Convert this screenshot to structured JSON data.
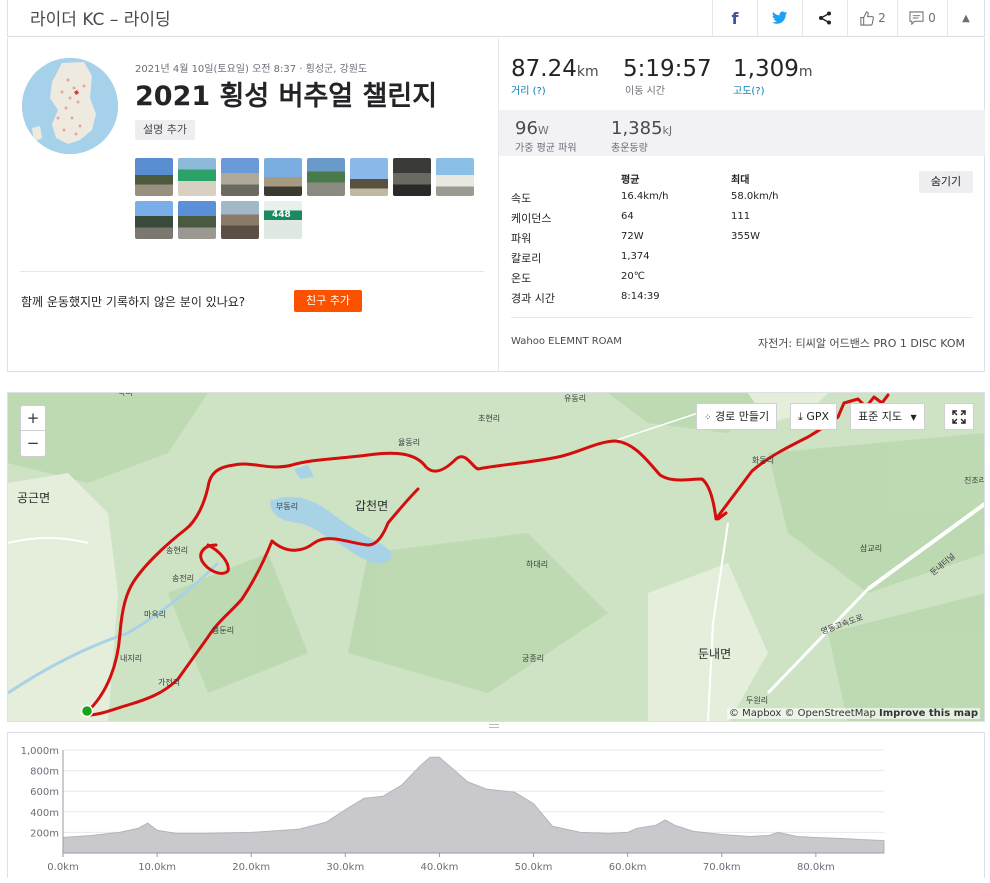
{
  "header": {
    "title": "라이더 KC – 라이딩",
    "kudos_count": "2",
    "comment_count": "0"
  },
  "activity": {
    "meta": "2021년 4월 10일(토요일) 오전 8:37 · 횡성군, 강원도",
    "title": "2021 횡성 버추얼 챌린지",
    "add_description": "설명 추가",
    "friends_question": "함께 운동했지만 기록하지 않은 분이 있나요?",
    "add_friends": "친구 추가",
    "photo_sign_text": "448"
  },
  "stats": {
    "distance": {
      "value": "87.24",
      "unit": "km",
      "label": "거리 (?)"
    },
    "moving_time": {
      "value": "5:19:57",
      "label": "이동 시간"
    },
    "elevation": {
      "value": "1,309",
      "unit": "m",
      "label": "고도(?)"
    },
    "weighted_power": {
      "value": "96",
      "unit": "W",
      "label": "가중 평균 파워"
    },
    "total_work": {
      "value": "1,385",
      "unit": "kJ",
      "label": "총운동량"
    }
  },
  "detail_table": {
    "col_avg": "평균",
    "col_max": "최대",
    "hide_label": "숨기기",
    "rows": [
      {
        "label": "속도",
        "avg": "16.4km/h",
        "max": "58.0km/h"
      },
      {
        "label": "케이던스",
        "avg": "64",
        "max": "111"
      },
      {
        "label": "파워",
        "avg": "72W",
        "max": "355W"
      },
      {
        "label": "칼로리",
        "avg": "1,374",
        "max": ""
      },
      {
        "label": "온도",
        "avg": "20℃",
        "max": ""
      },
      {
        "label": "경과 시간",
        "avg": "8:14:39",
        "max": ""
      }
    ],
    "device": "Wahoo ELEMNT ROAM",
    "bike": "자전거: 티씨알 어드밴스 PRO 1 DISC KOM"
  },
  "map": {
    "zoom_in": "+",
    "zoom_out": "−",
    "route_builder": "경로 만들기",
    "gpx": "GPX",
    "map_type": "표준 지도",
    "attribution_a": "© Mapbox © OpenStreetMap",
    "attribution_b": "Improve this map",
    "labels": {
      "gonggeun": "공근면",
      "gapcheon": "갑천면",
      "dunnae": "둔내면",
      "yudong": "유동리",
      "chohyeon": "초현리",
      "yuldong": "율동리",
      "budong": "부동리",
      "songhyeon1": "송현리",
      "songjeon": "송전리",
      "maok": "마옥리",
      "naeji": "내지리",
      "gajeon": "가전리",
      "yongdun": "용둔리",
      "hadae": "하대리",
      "gungjong": "궁종리",
      "dugwon": "두원리",
      "samgyo": "삼교리",
      "jinjo": "진조리",
      "tunnel": "둔내터널",
      "highway": "영동고속도로",
      "hwadong": "화동리",
      "lbl_top": "북리"
    }
  },
  "elevation_chart": {
    "type": "area",
    "x_ticks": [
      "0.0km",
      "10.0km",
      "20.0km",
      "30.0km",
      "40.0km",
      "50.0km",
      "60.0km",
      "70.0km",
      "80.0km"
    ],
    "y_ticks": [
      "200m",
      "400m",
      "600m",
      "800m",
      "1,000m"
    ],
    "xlim": [
      0,
      87.24
    ],
    "ylim": [
      0,
      1000
    ],
    "x": [
      0,
      3,
      6,
      8,
      9,
      10,
      12,
      15,
      20,
      25,
      28,
      30,
      32,
      34,
      36,
      38,
      39,
      40,
      41,
      43,
      45,
      48,
      50,
      52,
      55,
      58,
      60,
      61,
      63,
      64,
      65,
      67,
      70,
      73,
      75,
      76,
      78,
      80,
      83,
      85,
      87.24
    ],
    "values": [
      150,
      170,
      200,
      240,
      290,
      220,
      190,
      190,
      200,
      230,
      300,
      420,
      530,
      550,
      660,
      850,
      930,
      930,
      850,
      690,
      620,
      590,
      480,
      260,
      200,
      190,
      200,
      240,
      270,
      320,
      270,
      210,
      180,
      160,
      170,
      200,
      160,
      150,
      140,
      130,
      120
    ]
  }
}
